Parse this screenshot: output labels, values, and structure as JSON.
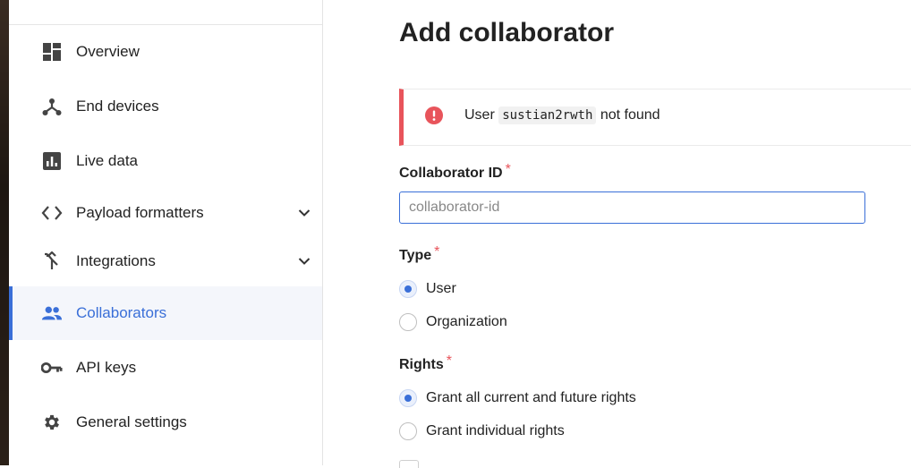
{
  "sidebar": {
    "items": [
      {
        "label": "Overview",
        "icon": "dashboard-icon"
      },
      {
        "label": "End devices",
        "icon": "device-hub-icon"
      },
      {
        "label": "Live data",
        "icon": "chart-icon"
      },
      {
        "label": "Payload formatters",
        "icon": "code-icon"
      },
      {
        "label": "Integrations",
        "icon": "merge-icon"
      },
      {
        "label": "Collaborators",
        "icon": "people-icon",
        "active": true
      },
      {
        "label": "API keys",
        "icon": "key-icon"
      },
      {
        "label": "General settings",
        "icon": "gear-icon"
      }
    ]
  },
  "main": {
    "title": "Add collaborator",
    "alert": {
      "prefix": "User",
      "code": "sustian2rwth",
      "suffix": "not found",
      "icon": "error-icon",
      "color": "#e8545b"
    },
    "collaborator_id": {
      "label": "Collaborator ID",
      "required_mark": "*",
      "placeholder": "collaborator-id",
      "value": ""
    },
    "type": {
      "label": "Type",
      "required_mark": "*",
      "options": [
        "User",
        "Organization"
      ],
      "selected": "User"
    },
    "rights": {
      "label": "Rights",
      "required_mark": "*",
      "options": [
        "Grant all current and future rights",
        "Grant individual rights"
      ],
      "selected": "Grant all current and future rights"
    }
  },
  "colors": {
    "accent": "#3a6fd8",
    "error": "#e8545b"
  }
}
